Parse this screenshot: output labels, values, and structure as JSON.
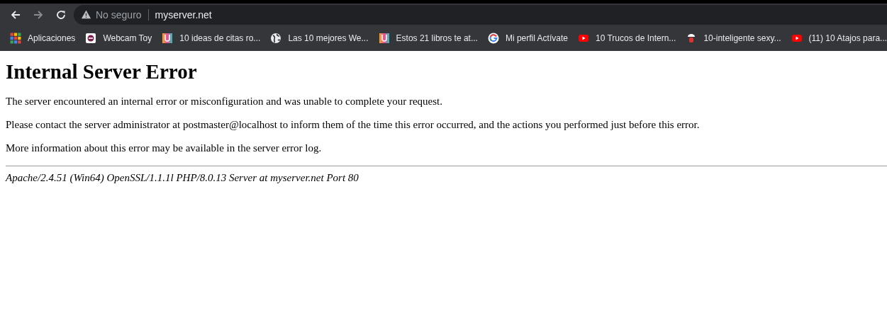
{
  "address_bar": {
    "security_label": "No seguro",
    "url": "myserver.net"
  },
  "bookmarks": [
    {
      "kind": "apps",
      "label": "Aplicaciones"
    },
    {
      "kind": "webcam",
      "label": "Webcam Toy"
    },
    {
      "kind": "ulogo",
      "label": "10 ideas de citas ro..."
    },
    {
      "kind": "globe",
      "label": "Las 10 mejores We..."
    },
    {
      "kind": "ulogo",
      "label": "Estos 21 libros te at..."
    },
    {
      "kind": "google",
      "label": "Mi perfil Actívate"
    },
    {
      "kind": "youtube",
      "label": "10 Trucos de Intern..."
    },
    {
      "kind": "figure",
      "label": "10-inteligente sexy..."
    },
    {
      "kind": "youtube",
      "label": "(11) 10 Atajos para..."
    }
  ],
  "page": {
    "heading": "Internal Server Error",
    "paragraphs": [
      "The server encountered an internal error or misconfiguration and was unable to complete your request.",
      "Please contact the server administrator at postmaster@localhost to inform them of the time this error occurred, and the actions you performed just before this error.",
      "More information about this error may be available in the server error log."
    ],
    "signature": "Apache/2.4.51 (Win64) OpenSSL/1.1.1l PHP/8.0.13 Server at myserver.net Port 80"
  }
}
